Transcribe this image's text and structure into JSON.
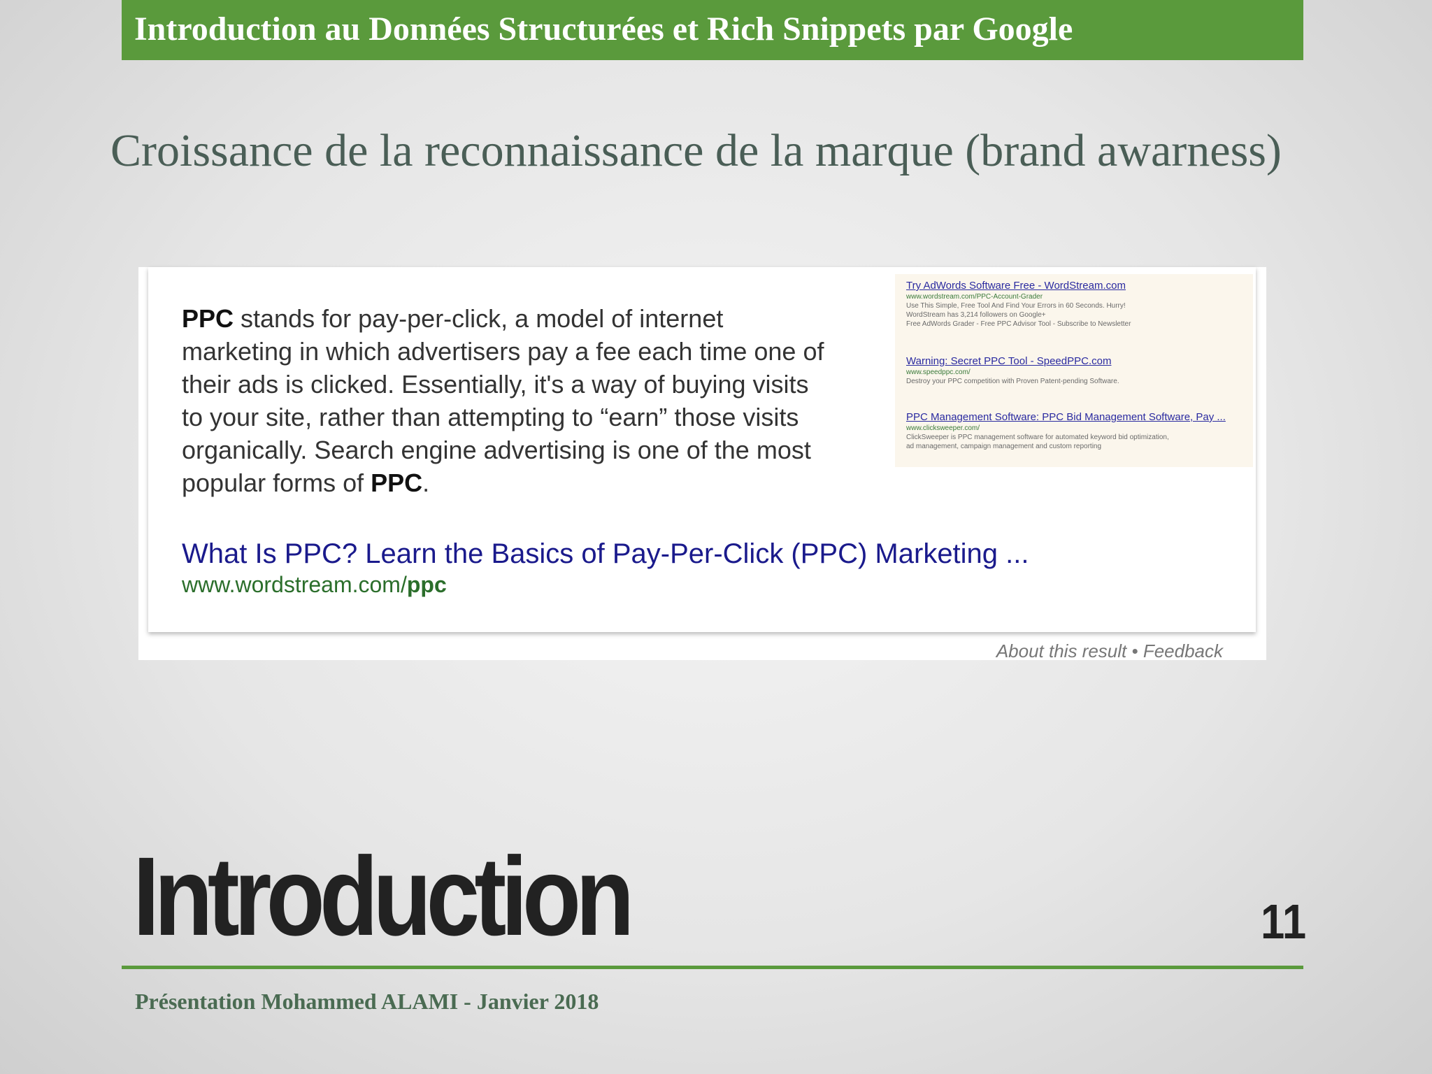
{
  "header": {
    "title": "Introduction au Données Structurées et Rich Snippets par Google",
    "bar_color": "#5a9a3c"
  },
  "slide": {
    "subtitle": "Croissance de la reconnaissance de la marque (brand awarness)",
    "section_title": "Introduction",
    "page_number": "11"
  },
  "snippet": {
    "definition_parts": [
      {
        "text": "PPC",
        "bold": true
      },
      {
        "text": " stands for pay-per-click, a model of internet marketing in which advertisers pay a fee each time one of their ads is clicked. Essentially, it's a way of buying visits to your site, rather than attempting to “earn” those visits organically. Search engine advertising is one of the most popular forms of ",
        "bold": false
      },
      {
        "text": "PPC",
        "bold": true
      },
      {
        "text": ".",
        "bold": false
      }
    ],
    "result_title": "What Is PPC? Learn the Basics of Pay-Per-Click (PPC) Marketing ...",
    "result_url_prefix": "www.wordstream.com/",
    "result_url_bold": "ppc",
    "about": "About this result",
    "separator": " • ",
    "feedback": "Feedback"
  },
  "ads": [
    {
      "title": "Try AdWords Software Free - WordStream.com",
      "url": "www.wordstream.com/PPC-Account-Grader",
      "lines": [
        "Use This Simple, Free Tool And Find Your Errors in 60 Seconds. Hurry!",
        "WordStream has 3,214 followers on Google+",
        "Free AdWords Grader - Free PPC Advisor Tool - Subscribe to Newsletter"
      ]
    },
    {
      "title": "Warning: Secret PPC Tool - SpeedPPC.com",
      "url": "www.speedppc.com/",
      "lines": [
        "Destroy your PPC competition with Proven Patent-pending Software."
      ]
    },
    {
      "title": "PPC Management Software: PPC Bid Management Software, Pay ...",
      "url": "www.clicksweeper.com/",
      "lines": [
        "ClickSweeper is PPC management software for automated keyword bid optimization,",
        "ad management, campaign management and custom reporting"
      ]
    }
  ],
  "footer": {
    "text": "Présentation Mohammed ALAMI - Janvier 2018"
  }
}
